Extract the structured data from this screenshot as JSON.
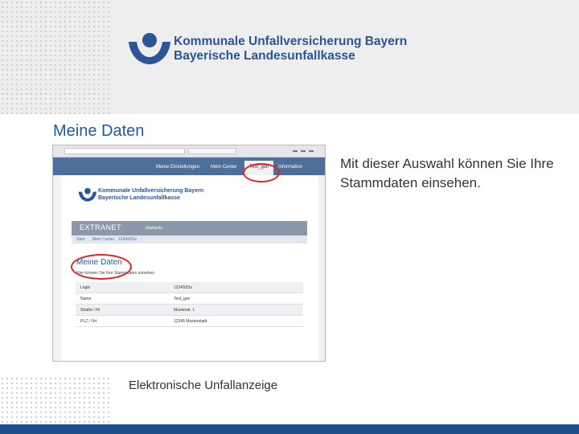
{
  "header": {
    "logo_line1": "Kommunale Unfallversicherung Bayern",
    "logo_line2": "Bayerische Landesunfallkasse"
  },
  "slide": {
    "title": "Meine Daten",
    "description": "Mit dieser Auswahl können Sie Ihre Stammdaten einsehen.",
    "caption": "Elektronische Unfallanzeige"
  },
  "colors": {
    "brand_blue": "#2a5597",
    "title_blue": "#1f5aa6",
    "highlight_red": "#e02424",
    "footer_blue": "#1f4e8c"
  },
  "screenshot": {
    "nav": {
      "items": [
        "Meine Einstellungen",
        "Mein Center",
        "Test_gon",
        "Information"
      ],
      "active_index": 2
    },
    "logo_line1": "Kommunale Unfallversicherung Bayern",
    "logo_line2": "Bayerische Landesunfallkasse",
    "banner_title": "EXTRANET",
    "banner_link": "Startseite",
    "breadcrumbs": [
      "Start",
      "Mein Center",
      "1234S5Sz"
    ],
    "page_title": "Meine Daten",
    "subtitle": "Hier können Sie Ihre Stammdaten einsehen",
    "rows": [
      {
        "label": "Login",
        "value": "1234S5Sz"
      },
      {
        "label": "Name",
        "value": "Test_gon"
      },
      {
        "label": "Straße / Nr",
        "value": "Musterstr. 1"
      },
      {
        "label": "PLZ / Ort",
        "value": "12345 Musterstadt"
      }
    ]
  }
}
